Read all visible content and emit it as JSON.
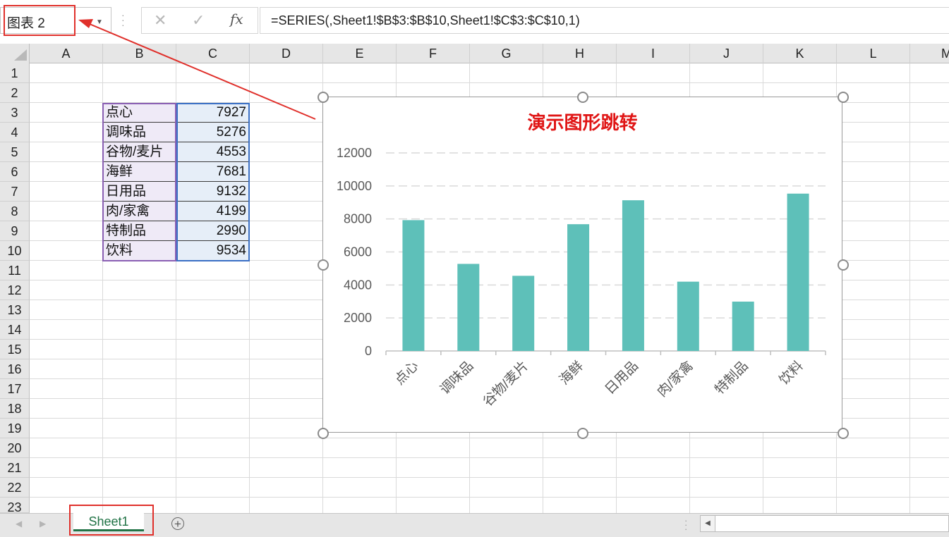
{
  "namebox": {
    "value": "图表 2"
  },
  "formula_bar": {
    "cancel_icon": "✕",
    "enter_icon": "✓",
    "fx_label": "fx",
    "formula": "=SERIES(,Sheet1!$B$3:$B$10,Sheet1!$C$3:$C$10,1)"
  },
  "columns": [
    "A",
    "B",
    "C",
    "D",
    "E",
    "F",
    "G",
    "H",
    "I",
    "J",
    "K",
    "L",
    "M"
  ],
  "rows": [
    "1",
    "2",
    "3",
    "4",
    "5",
    "6",
    "7",
    "8",
    "9",
    "10",
    "11",
    "12",
    "13",
    "14",
    "15",
    "16",
    "17",
    "18",
    "19",
    "20",
    "21",
    "22",
    "23"
  ],
  "table": [
    {
      "category": "点心",
      "value": "7927"
    },
    {
      "category": "调味品",
      "value": "5276"
    },
    {
      "category": "谷物/麦片",
      "value": "4553"
    },
    {
      "category": "海鲜",
      "value": "7681"
    },
    {
      "category": "日用品",
      "value": "9132"
    },
    {
      "category": "肉/家禽",
      "value": "4199"
    },
    {
      "category": "特制品",
      "value": "2990"
    },
    {
      "category": "饮料",
      "value": "9534"
    }
  ],
  "chart_data": {
    "type": "bar",
    "title": "演示图形跳转",
    "categories": [
      "点心",
      "调味品",
      "谷物/麦片",
      "海鲜",
      "日用品",
      "肉/家禽",
      "特制品",
      "饮料"
    ],
    "values": [
      7927,
      5276,
      4553,
      7681,
      9132,
      4199,
      2990,
      9534
    ],
    "ylim": [
      0,
      12000
    ],
    "yticks": [
      "0",
      "2000",
      "4000",
      "6000",
      "8000",
      "10000",
      "12000"
    ],
    "grid": true,
    "bar_color": "#5ec0b9",
    "title_color": "#e01515"
  },
  "sheets": {
    "active": "Sheet1"
  },
  "accent_colors": {
    "annotation": "#e0302b",
    "sheet_tab": "#217346"
  }
}
